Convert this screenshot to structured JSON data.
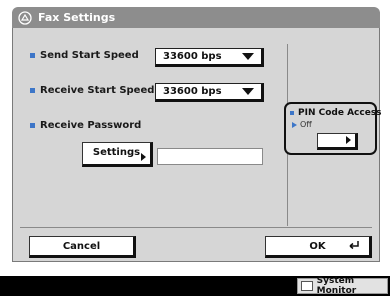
{
  "window": {
    "title": "Fax Settings"
  },
  "settings": {
    "send_start_speed": {
      "label": "Send Start Speed",
      "value": "33600 bps"
    },
    "receive_start_speed": {
      "label": "Receive Start Speed",
      "value": "33600 bps"
    },
    "receive_password": {
      "label": "Receive Password",
      "button_label": "Settings",
      "field_value": ""
    }
  },
  "pin_code_access": {
    "label": "PIN Code Access",
    "status": "Off"
  },
  "footer": {
    "cancel_label": "Cancel",
    "ok_label": "OK"
  },
  "status_bar": {
    "system_monitor_label": "System Monitor"
  },
  "colors": {
    "accent": "#3d76c8",
    "titlebar": "#8d8d8d",
    "panel": "#d6d6d6"
  }
}
